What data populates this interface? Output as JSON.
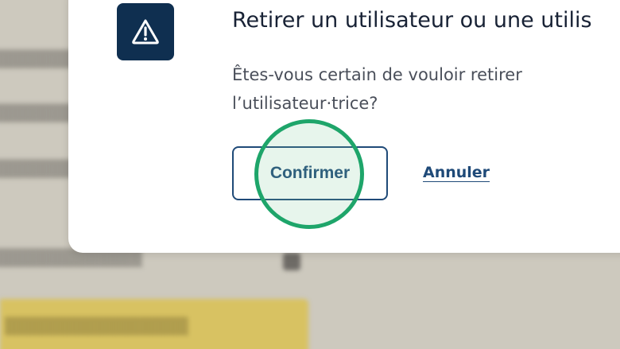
{
  "dialog": {
    "title": "Retirer un utilisateur ou une utilis",
    "message": "Êtes-vous certain de vouloir retirer l’utilisateur·trice?",
    "confirm_label": "Confirmer",
    "cancel_label": "Annuler",
    "icon": "warning-icon"
  },
  "colors": {
    "accent": "#1f4a78",
    "icon_bg": "#0f2f50",
    "highlight": "#1ea56a",
    "cta_bg": "#d8c262"
  }
}
